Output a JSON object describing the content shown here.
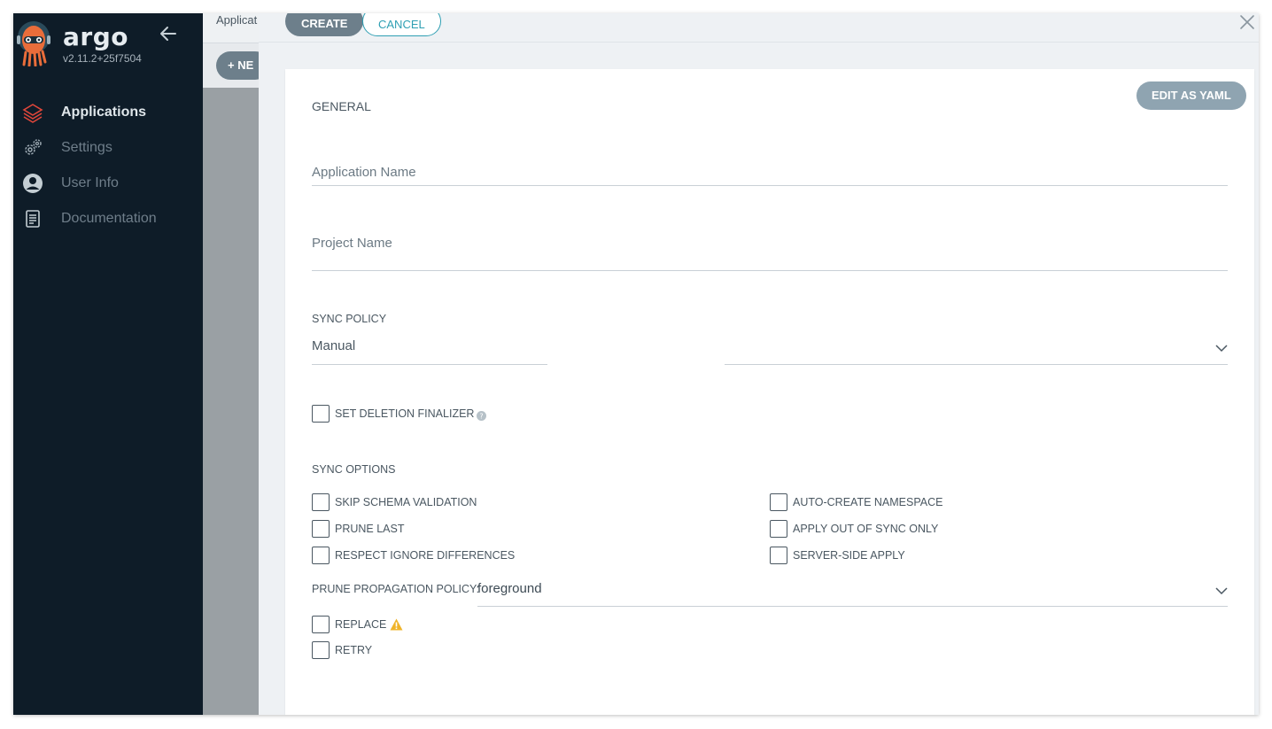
{
  "sidebar": {
    "brand": "argo",
    "version": "v2.11.2+25f7504",
    "items": [
      {
        "label": "Applications",
        "icon": "layers-icon",
        "active": true
      },
      {
        "label": "Settings",
        "icon": "gears-icon",
        "active": false
      },
      {
        "label": "User Info",
        "icon": "user-circle-icon",
        "active": false
      },
      {
        "label": "Documentation",
        "icon": "book-icon",
        "active": false
      }
    ]
  },
  "background": {
    "breadcrumb": "Applicat",
    "new_button": "+ NE"
  },
  "panel": {
    "create_label": "CREATE",
    "cancel_label": "CANCEL",
    "edit_yaml_label": "EDIT AS YAML",
    "general_title": "GENERAL",
    "application_name_placeholder": "Application Name",
    "project_name_placeholder": "Project Name",
    "sync_policy_label": "SYNC POLICY",
    "sync_policy_value": "Manual",
    "set_deletion_finalizer": "SET DELETION FINALIZER",
    "sync_options_title": "SYNC OPTIONS",
    "sync_options_left": [
      "SKIP SCHEMA VALIDATION",
      "PRUNE LAST",
      "RESPECT IGNORE DIFFERENCES"
    ],
    "sync_options_right": [
      "AUTO-CREATE NAMESPACE",
      "APPLY OUT OF SYNC ONLY",
      "SERVER-SIDE APPLY"
    ],
    "prune_policy_label": "PRUNE PROPAGATION POLICY:",
    "prune_policy_value": "foreground",
    "replace_label": "REPLACE",
    "retry_label": "RETRY"
  },
  "colors": {
    "sidebar_bg": "#0e1c28",
    "primary_button": "#6d7f8b",
    "cancel_accent": "#2e9fb3",
    "yaml_button": "#8fa4b1",
    "warning": "#f0b429",
    "logo_orange": "#e96d3a"
  }
}
